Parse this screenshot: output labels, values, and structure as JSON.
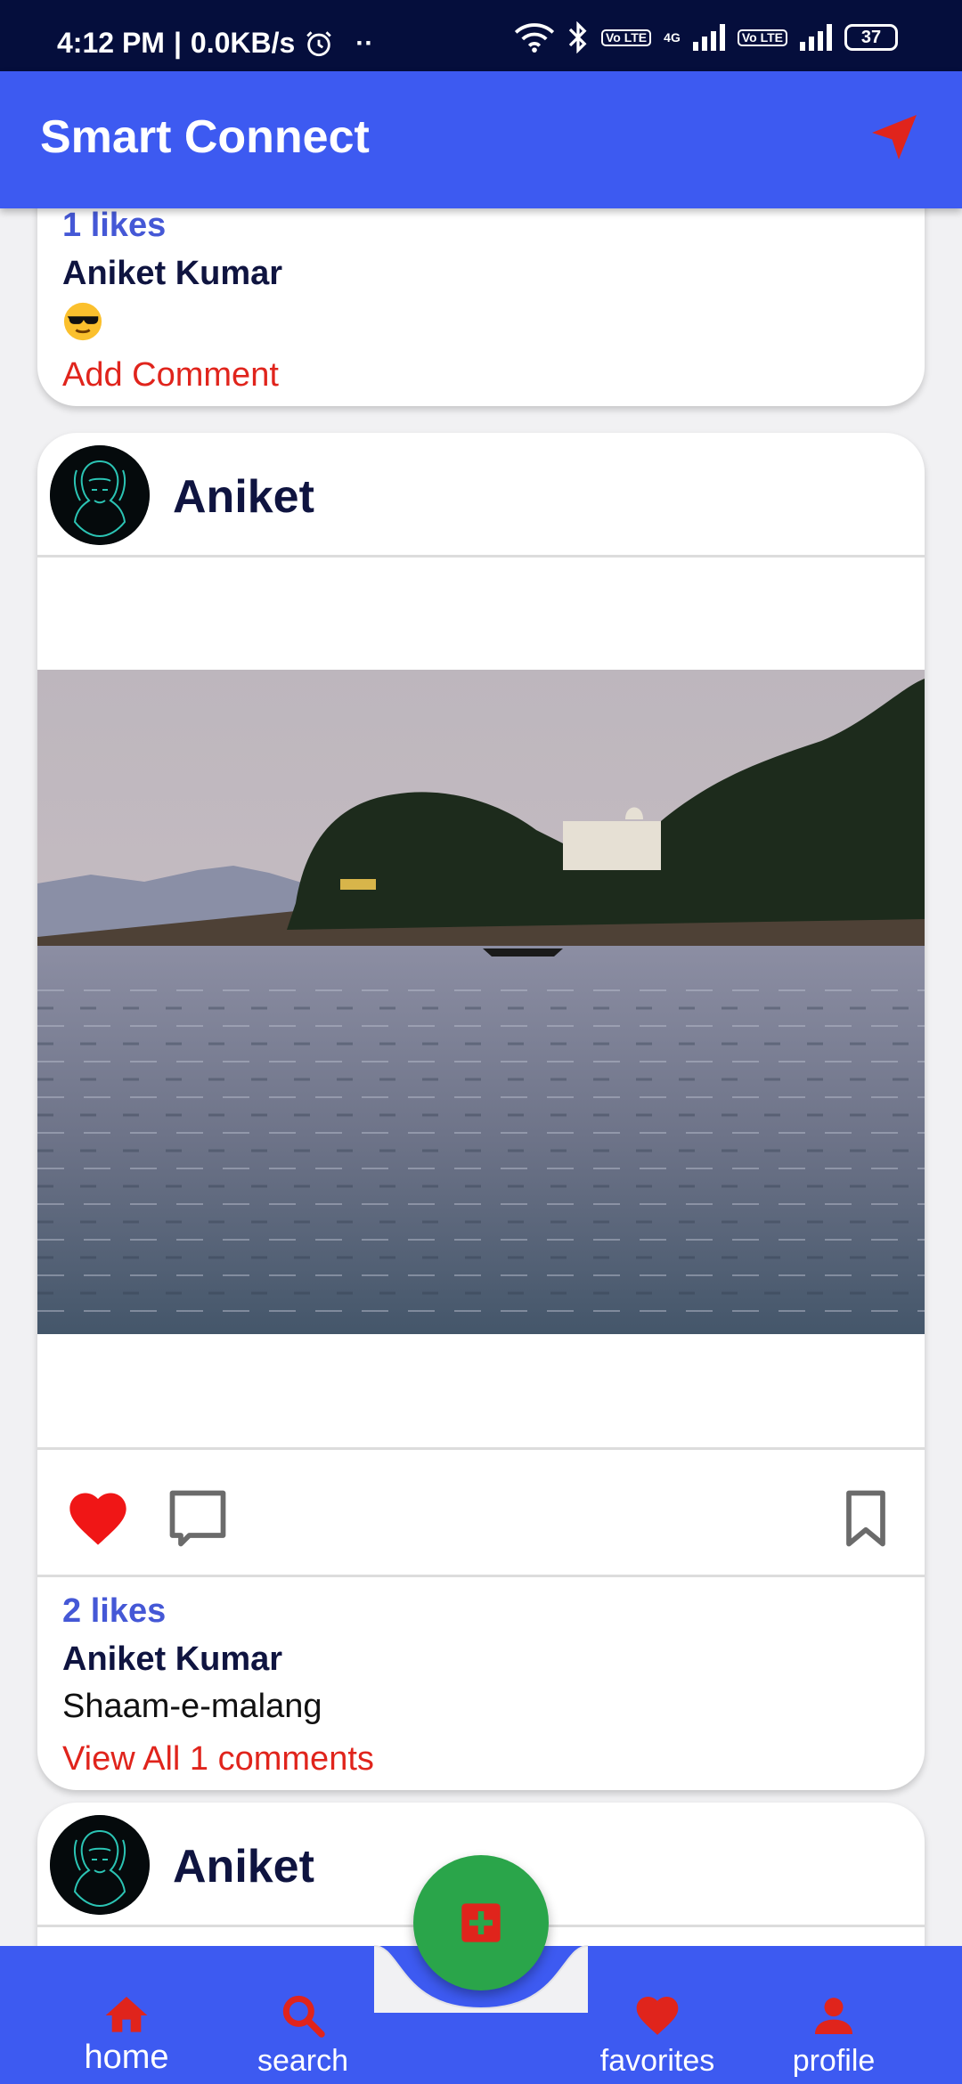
{
  "status_bar": {
    "time": "4:12 PM",
    "speed": "0.0KB/s",
    "network": "4G",
    "volte": "Vo LTE",
    "battery": "37"
  },
  "app_bar": {
    "title": "Smart Connect"
  },
  "posts": [
    {
      "likes": "1 likes",
      "author": "Aniket Kumar",
      "caption_emoji": "smiling-face-with-sunglasses",
      "comment_link": "Add Comment"
    },
    {
      "username": "Aniket",
      "likes": "2 likes",
      "author": "Aniket Kumar",
      "caption": "Shaam-e-malang",
      "comment_link": "View All 1 comments",
      "liked": true
    },
    {
      "username": "Aniket"
    }
  ],
  "bottom_nav": {
    "items": [
      {
        "label": "home",
        "icon": "home-icon"
      },
      {
        "label": "search",
        "icon": "search-icon"
      },
      {
        "label": "favorites",
        "icon": "heart-icon"
      },
      {
        "label": "profile",
        "icon": "person-icon"
      }
    ],
    "fab_icon": "add-box-icon"
  },
  "colors": {
    "app_bar": "#3d5af1",
    "status_bar": "#050e3c",
    "accent_red": "#e0241c",
    "likes_blue": "#4558d6",
    "fab_green": "#2aa54a"
  }
}
